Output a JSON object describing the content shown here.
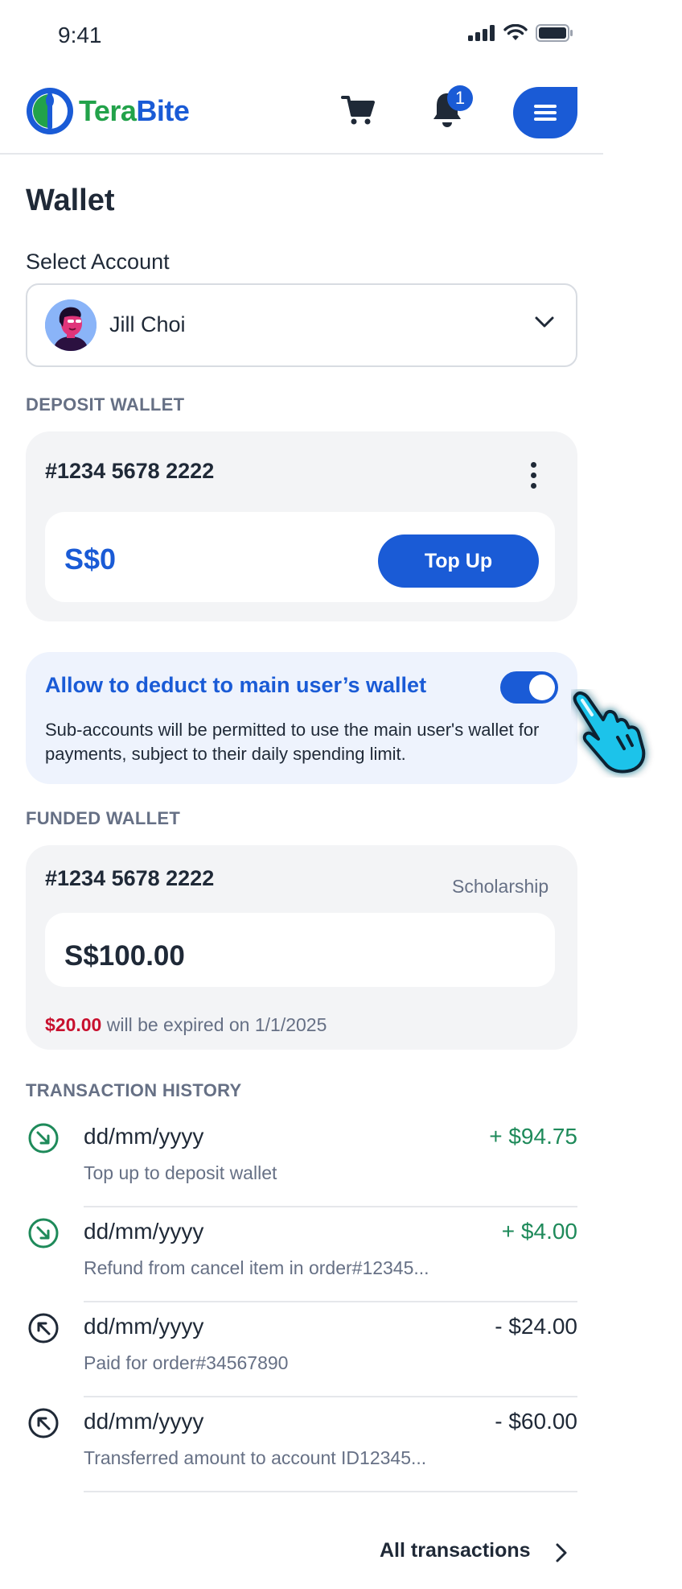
{
  "status_bar": {
    "time": "9:41"
  },
  "header": {
    "logo_part1": "Tera",
    "logo_part2": "Bite",
    "notification_count": "1"
  },
  "page": {
    "title": "Wallet"
  },
  "account_select": {
    "label": "Select Account",
    "selected": "Jill Choi"
  },
  "deposit_wallet": {
    "section_label": "DEPOSIT WALLET",
    "account_number": "#1234 5678 2222",
    "balance": "S$0",
    "topup_label": "Top Up"
  },
  "allow_deduct": {
    "title": "Allow to deduct to main user’s wallet",
    "description": "Sub-accounts will be permitted to use the main user's wallet for payments, subject to their daily spending limit.",
    "enabled": true
  },
  "funded_wallet": {
    "section_label": "FUNDED WALLET",
    "account_number": "#1234 5678 2222",
    "type": "Scholarship",
    "balance": "S$100.00",
    "expiring_amount": "$20.00",
    "expiring_text": " will be expired on 1/1/2025"
  },
  "transactions": {
    "section_label": "TRANSACTION HISTORY",
    "items": [
      {
        "date": "dd/mm/yyyy",
        "description": "Top up to deposit wallet",
        "amount": "+ $94.75",
        "direction": "in"
      },
      {
        "date": "dd/mm/yyyy",
        "description": "Refund from cancel item in order#12345...",
        "amount": "+ $4.00",
        "direction": "in"
      },
      {
        "date": "dd/mm/yyyy",
        "description": "Paid for order#34567890",
        "amount": "- $24.00",
        "direction": "out"
      },
      {
        "date": "dd/mm/yyyy",
        "description": "Transferred amount to account ID12345...",
        "amount": "- $60.00",
        "direction": "out"
      }
    ],
    "all_link": "All transactions"
  },
  "colors": {
    "primary": "#1a5bd6",
    "positive": "#1e8a5a",
    "danger": "#c8102e",
    "brand_green": "#22a24a"
  }
}
